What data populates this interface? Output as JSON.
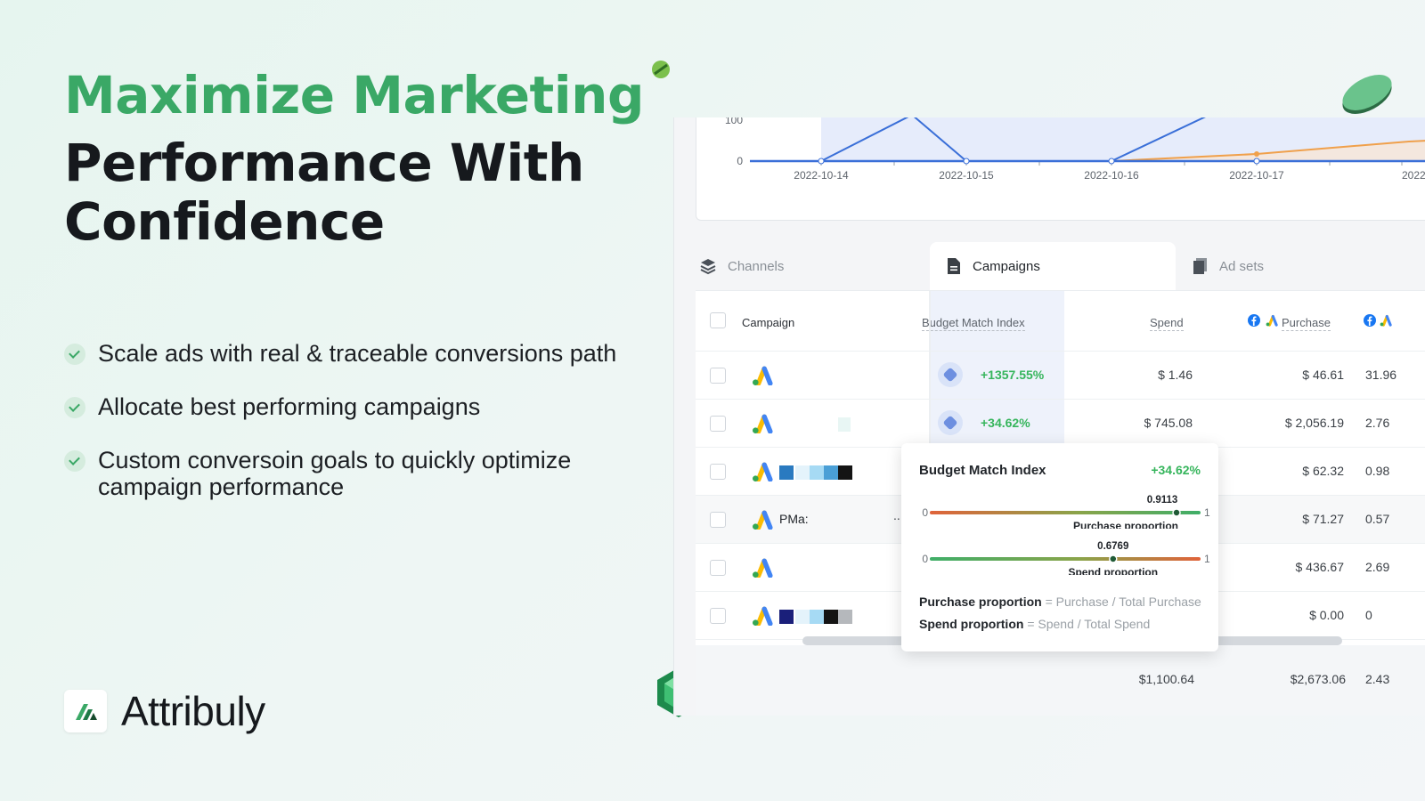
{
  "hero": {
    "title_accent": "Maximize Marketing",
    "title_main": "Performance With Confidence"
  },
  "bullets": [
    "Scale ads with real & traceable conversions path",
    "Allocate best performing campaigns",
    "Custom conversoin goals to quickly optimize campaign performance"
  ],
  "brand": {
    "name": "Attribuly",
    "logo_icon": "attribuly-logo-icon"
  },
  "colors": {
    "accent": "#3aa866",
    "positive": "#36b55c",
    "chart_blue": "#3a6fd8",
    "chart_orange": "#f0a04b"
  },
  "chart": {
    "y_ticks": [
      "100",
      "0"
    ],
    "x_ticks": [
      "2022-10-14",
      "2022-10-15",
      "2022-10-16",
      "2022-10-17",
      "2022"
    ]
  },
  "tabs": [
    {
      "label": "Channels",
      "icon": "layers-icon"
    },
    {
      "label": "Campaigns",
      "icon": "document-icon"
    },
    {
      "label": "Ad sets",
      "icon": "pages-icon"
    }
  ],
  "table": {
    "headers": {
      "campaign": "Campaign",
      "bmi": "Budget Match Index",
      "spend": "Spend",
      "purchase": "Purchase"
    },
    "rows": [
      {
        "name": "",
        "bmi": "+1357.55%",
        "spend": "$ 1.46",
        "purchase": "$ 46.61",
        "roas": "31.96"
      },
      {
        "name": "",
        "bmi": "+34.62%",
        "spend": "$ 745.08",
        "purchase": "$ 2,056.19",
        "roas": "2.76"
      },
      {
        "name": "",
        "bmi": "",
        "spend": "",
        "purchase": "$ 62.32",
        "roas": "0.98"
      },
      {
        "name": "PMa:",
        "bmi": "",
        "spend": "",
        "purchase": "$ 71.27",
        "roas": "0.57"
      },
      {
        "name": "",
        "bmi": "",
        "spend": "",
        "purchase": "$ 436.67",
        "roas": "2.69"
      },
      {
        "name": "",
        "bmi": "",
        "spend": "",
        "purchase": "$ 0.00",
        "roas": "0"
      }
    ],
    "row4_ellipsis": "...",
    "totals": {
      "spend": "$1,100.64",
      "purchase": "$2,673.06",
      "roas": "2.43"
    }
  },
  "tooltip": {
    "title": "Budget Match Index",
    "value": "+34.62%",
    "purchase_value": "0.9113",
    "purchase_fraction": 0.9113,
    "purchase_label": "Purchase proportion",
    "spend_value": "0.6769",
    "spend_fraction": 0.6769,
    "spend_label": "Spend proportion",
    "scale_min": "0",
    "scale_max": "1",
    "formula1_term": "Purchase proportion",
    "formula1_rest": "= Purchase / Total Purchase",
    "formula2_term": "Spend proportion",
    "formula2_rest": "= Spend / Total Spend"
  }
}
